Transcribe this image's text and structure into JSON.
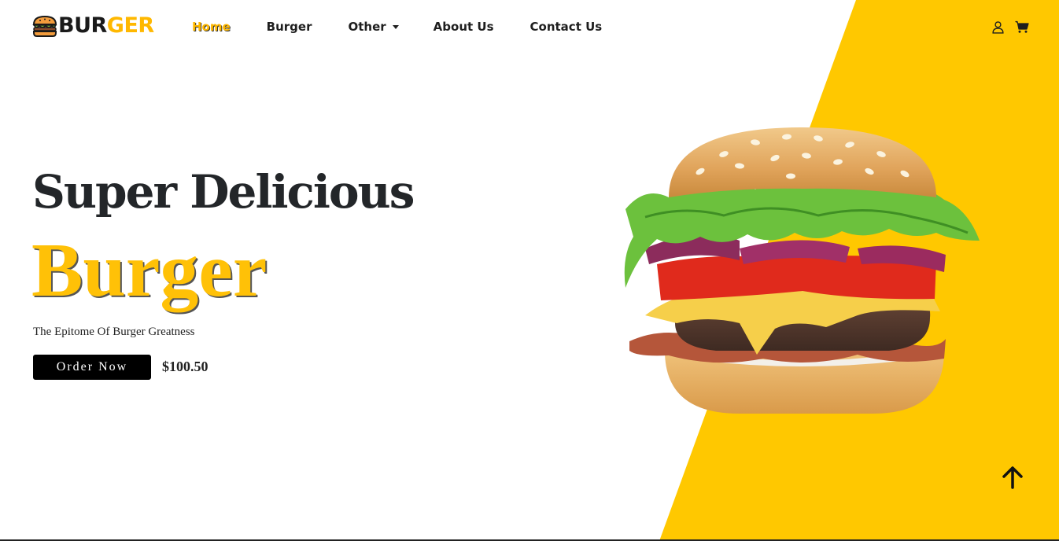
{
  "brand": {
    "text_part1": "BUR",
    "text_part2": "GER",
    "icon": "burger-logo-icon",
    "accent_color": "#ffc800"
  },
  "nav": {
    "items": [
      {
        "label": "Home",
        "active": true
      },
      {
        "label": "Burger",
        "active": false
      },
      {
        "label": "Other",
        "active": false,
        "has_dropdown": true
      },
      {
        "label": "About Us",
        "active": false
      },
      {
        "label": "Contact Us",
        "active": false
      }
    ],
    "icons": [
      "user-icon",
      "shopping-cart-icon"
    ]
  },
  "hero": {
    "line1": "Super Delicious",
    "line2": "Burger",
    "tagline": "The Epitome Of Burger Greatness",
    "cta_label": "Order Now",
    "price": "$100.50",
    "image": "cheeseburger-photo"
  },
  "scroll_top": {
    "icon": "arrow-up-icon"
  },
  "colors": {
    "yellow": "#ffc800",
    "headline_yellow": "#ffc107",
    "dark": "#232629",
    "button_bg": "#000000"
  }
}
